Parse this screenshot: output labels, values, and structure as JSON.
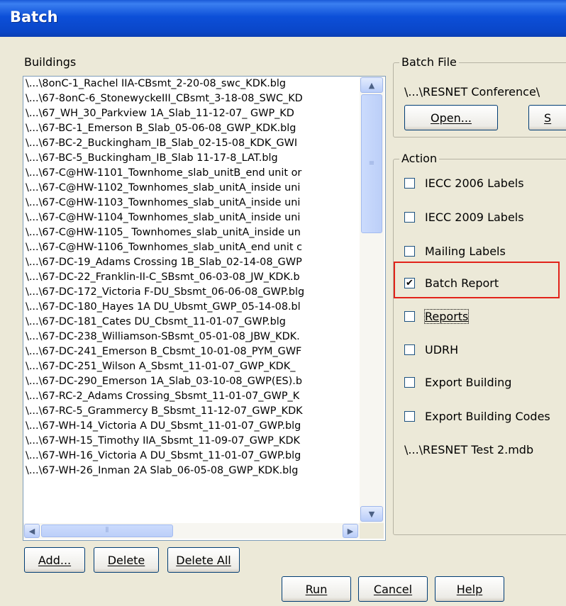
{
  "window": {
    "title": "Batch"
  },
  "buildings": {
    "label": "Buildings",
    "items": [
      "\\...\\8onC-1_Rachel IIA-CBsmt_2-20-08_swc_KDK.blg",
      "\\...\\67-8onC-6_StonewyckeIII_CBsmt_3-18-08_SWC_KD",
      "\\...\\67_WH_30_Parkview 1A_Slab_11-12-07_ GWP_KD",
      "\\...\\67-BC-1_Emerson B_Slab_05-06-08_GWP_KDK.blg",
      "\\...\\67-BC-2_Buckingham_IB_Slab_02-15-08_KDK_GWI",
      "\\...\\67-BC-5_Buckingham_IB_Slab 11-17-8_LAT.blg",
      "\\...\\67-C@HW-1101_Townhome_slab_unitB_end unit or",
      "\\...\\67-C@HW-1102_Townhomes_slab_unitA_inside uni",
      "\\...\\67-C@HW-1103_Townhomes_slab_unitA_inside uni",
      "\\...\\67-C@HW-1104_Townhomes_slab_unitA_inside uni",
      "\\...\\67-C@HW-1105_ Townhomes_slab_unitA_inside un",
      "\\...\\67-C@HW-1106_Townhomes_slab_unitA_end unit c",
      "\\...\\67-DC-19_Adams Crossing 1B_Slab_02-14-08_GWP",
      "\\...\\67-DC-22_Franklin-II-C_SBsmt_06-03-08_JW_KDK.b",
      "\\...\\67-DC-172_Victoria F-DU_Sbsmt_06-06-08_GWP.blg",
      "\\...\\67-DC-180_Hayes 1A DU_Ubsmt_GWP_05-14-08.bl",
      "\\...\\67-DC-181_Cates DU_Cbsmt_11-01-07_GWP.blg",
      "\\...\\67-DC-238_Williamson-SBsmt_05-01-08_JBW_KDK.",
      "\\...\\67-DC-241_Emerson B_Cbsmt_10-01-08_PYM_GWF",
      "\\...\\67-DC-251_Wilson A_Sbsmt_11-01-07_GWP_KDK_",
      "\\...\\67-DC-290_Emerson 1A_Slab_03-10-08_GWP(ES).b",
      "\\...\\67-RC-2_Adams Crossing_Sbsmt_11-01-07_GWP_K",
      "\\...\\67-RC-5_Grammercy B_Sbsmt_11-12-07_GWP_KDK",
      "\\...\\67-WH-14_Victoria A DU_Sbsmt_11-01-07_GWP.blg",
      "\\...\\67-WH-15_Timothy IIA_Sbsmt_11-09-07_GWP_KDK",
      "\\...\\67-WH-16_Victoria A DU_Sbsmt_11-01-07_GWP.blg",
      "\\...\\67-WH-26_Inman 2A Slab_06-05-08_GWP_KDK.blg"
    ],
    "buttons": {
      "add": "Add...",
      "delete": "Delete",
      "delete_all": "Delete All"
    }
  },
  "batch_file": {
    "label": "Batch File",
    "path": "\\...\\RESNET Conference\\",
    "open_button": "Open...",
    "save_button": "S"
  },
  "action": {
    "label": "Action",
    "options": [
      {
        "label": "IECC 2006 Labels",
        "checked": false
      },
      {
        "label": "IECC 2009 Labels",
        "checked": false
      },
      {
        "label": "Mailing Labels",
        "checked": false
      },
      {
        "label": "Batch Report",
        "checked": true
      },
      {
        "label": "Reports",
        "checked": false
      },
      {
        "label": "UDRH",
        "checked": false
      },
      {
        "label": "Export Building",
        "checked": false
      },
      {
        "label": "Export Building Codes",
        "checked": false
      }
    ],
    "database_path": "\\...\\RESNET Test 2.mdb"
  },
  "footer": {
    "run": "Run",
    "cancel": "Cancel",
    "help": "Help"
  },
  "colors": {
    "titlebar": "#0a46c8",
    "dialog_bg": "#ece9d8",
    "highlight": "#e2231a"
  }
}
